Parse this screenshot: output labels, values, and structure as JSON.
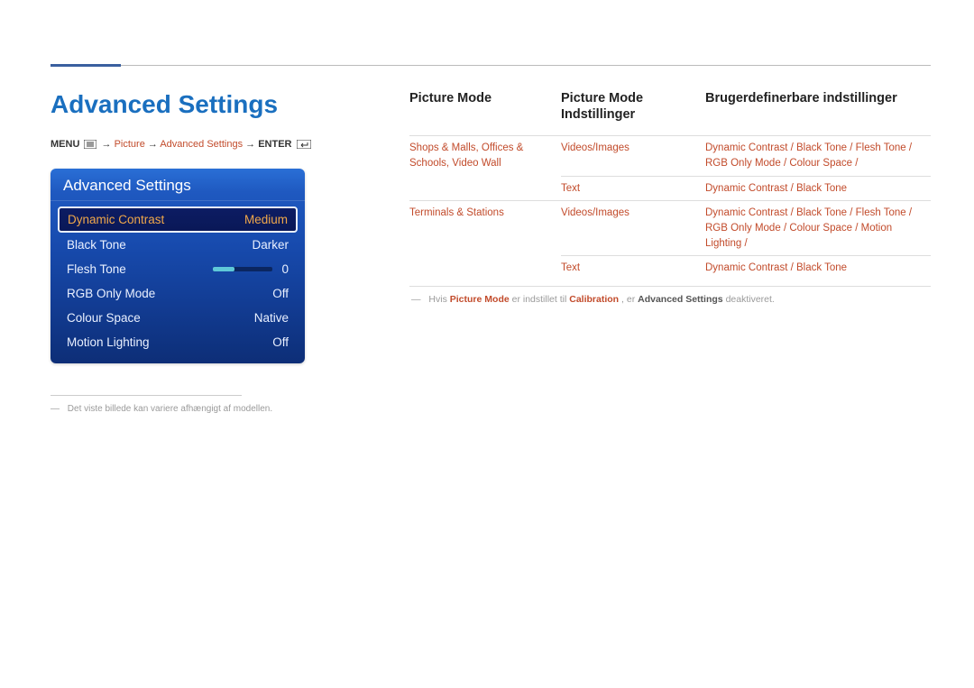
{
  "page_title": "Advanced Settings",
  "breadcrumb": {
    "menu": "MENU",
    "arrow": "→",
    "picture": "Picture",
    "advanced": "Advanced Settings",
    "enter": "ENTER"
  },
  "osd": {
    "title": "Advanced Settings",
    "rows": [
      {
        "label": "Dynamic Contrast",
        "value": "Medium",
        "selected": true
      },
      {
        "label": "Black Tone",
        "value": "Darker"
      },
      {
        "label": "Flesh Tone",
        "value": "0",
        "slider": true
      },
      {
        "label": "RGB Only Mode",
        "value": "Off"
      },
      {
        "label": "Colour Space",
        "value": "Native"
      },
      {
        "label": "Motion Lighting",
        "value": "Off"
      }
    ]
  },
  "footnote": "Det viste billede kan variere afhængigt af modellen.",
  "columns": {
    "c1": "Picture Mode",
    "c2": "Picture Mode Indstillinger",
    "c3": "Brugerdefinerbare indstillinger"
  },
  "table": [
    {
      "mode": "Shops & Malls, Offices & Schools, Video Wall",
      "sub": "Videos/Images",
      "opts": [
        "Dynamic Contrast",
        "Black Tone",
        "Flesh Tone",
        "RGB Only Mode",
        "Colour Space"
      ],
      "rowspan": 2
    },
    {
      "mode": "",
      "sub": "Text",
      "opts": [
        "Dynamic Contrast",
        "Black Tone"
      ]
    },
    {
      "mode": "Terminals & Stations",
      "sub": "Videos/Images",
      "opts": [
        "Dynamic Contrast",
        "Black Tone",
        "Flesh Tone",
        "RGB Only Mode",
        "Colour Space",
        "Motion Lighting"
      ],
      "rowspan": 2
    },
    {
      "mode": "",
      "sub": "Text",
      "opts": [
        "Dynamic Contrast",
        "Black Tone"
      ]
    }
  ],
  "calibration_note": {
    "pre": "Hvis",
    "pm": "Picture Mode",
    "mid1": "er indstillet til",
    "cal": "Calibration",
    "mid2": ", er",
    "adv": "Advanced Settings",
    "post": "deaktiveret."
  }
}
